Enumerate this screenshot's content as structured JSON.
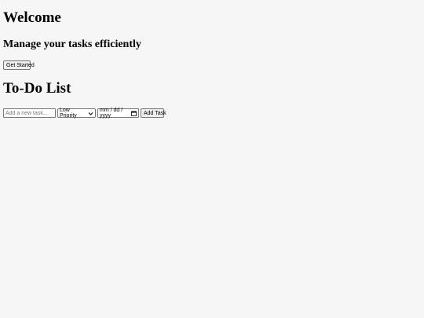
{
  "welcome": {
    "title": "Welcome",
    "subtitle": "Manage your tasks efficiently",
    "get_started_label": "Get Started"
  },
  "todo": {
    "title": "To-Do List",
    "task_input": {
      "value": "",
      "placeholder": "Add a new task..."
    },
    "priority": {
      "selected": "Low Priority"
    },
    "due_date": {
      "value": "mm / dd / yyyy"
    },
    "add_task_label": "Add Task"
  },
  "icons": {
    "select_arrow": "chevron-down-icon",
    "date_picker": "calendar-icon"
  }
}
